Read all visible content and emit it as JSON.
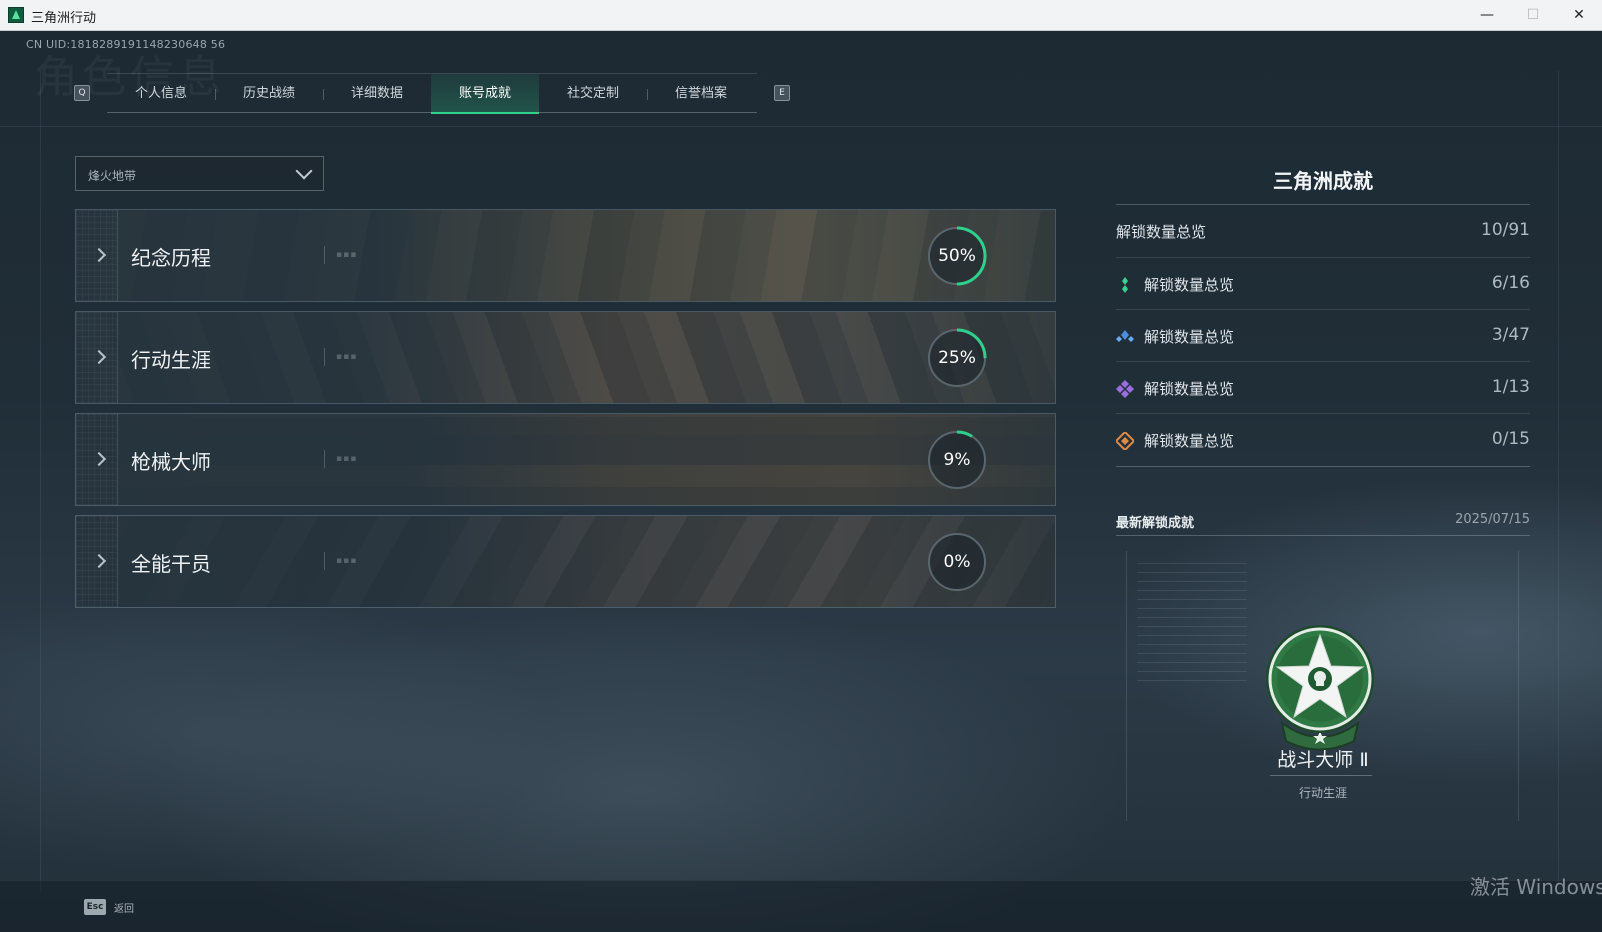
{
  "window": {
    "title": "三角洲行动",
    "minimize_glyph": "—",
    "maximize_glyph": "☐",
    "close_glyph": "✕"
  },
  "header": {
    "uid": "CN UID:1818289191148230648 56",
    "ghost_title": "角色信息"
  },
  "tabs": [
    {
      "label": "个人信息",
      "active": false
    },
    {
      "label": "历史战绩",
      "active": false
    },
    {
      "label": "详细数据",
      "active": false
    },
    {
      "label": "账号成就",
      "active": true
    },
    {
      "label": "社交定制",
      "active": false
    },
    {
      "label": "信誉档案",
      "active": false
    }
  ],
  "tab_keys": {
    "prev": "Q",
    "next": "E"
  },
  "mode_select": {
    "value": "烽火地带"
  },
  "categories": [
    {
      "label": "纪念历程",
      "percent": 50,
      "percent_label": "50%"
    },
    {
      "label": "行动生涯",
      "percent": 25,
      "percent_label": "25%"
    },
    {
      "label": "枪械大师",
      "percent": 9,
      "percent_label": "9%"
    },
    {
      "label": "全能干员",
      "percent": 0,
      "percent_label": "0%"
    }
  ],
  "panel": {
    "title": "三角洲成就",
    "total": {
      "label": "解锁数量总览",
      "value": "10/91"
    },
    "tiers": [
      {
        "label": "解锁数量总览",
        "value": "6/16",
        "color": "#3ccf8e",
        "icon": "green-gem-icon"
      },
      {
        "label": "解锁数量总览",
        "value": "3/47",
        "color": "#4a90e2",
        "icon": "blue-gem-icon"
      },
      {
        "label": "解锁数量总览",
        "value": "1/13",
        "color": "#9b6ee0",
        "icon": "purple-gem-icon"
      },
      {
        "label": "解锁数量总览",
        "value": "0/15",
        "color": "#e08a45",
        "icon": "orange-gem-icon"
      }
    ],
    "latest": {
      "label": "最新解锁成就",
      "date": "2025/07/15",
      "name": "战斗大师 Ⅱ",
      "category": "行动生涯"
    }
  },
  "footer": {
    "esc_key": "Esc",
    "esc_label": "返回",
    "watermark": "激活 Windows"
  },
  "colors": {
    "accent": "#2fd08c",
    "ring_track": "#5a666e"
  }
}
